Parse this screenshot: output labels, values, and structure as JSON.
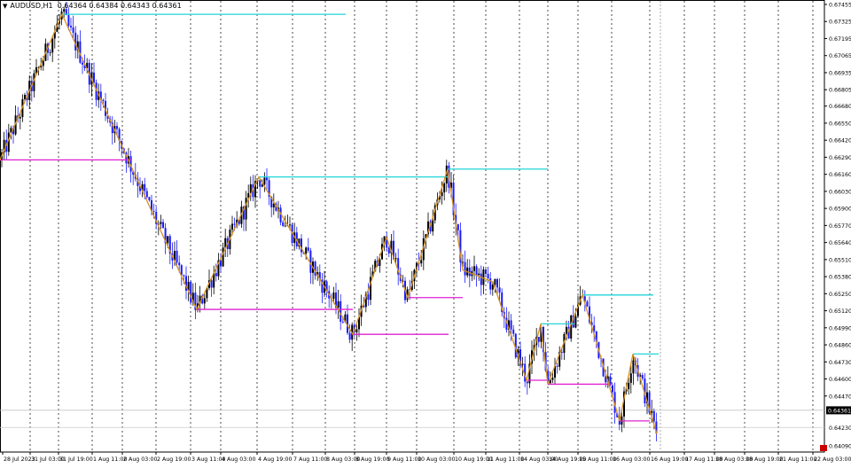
{
  "header": {
    "symbol": "AUDUSD,H1",
    "ohlc": "0.64364 0.64384 0.64343 0.64361"
  },
  "colors": {
    "bull": "#000000",
    "bear": "#1a1aff",
    "zigzag": "#d4901e",
    "support": "#e020d0",
    "resistance": "#22d4d8",
    "grid": "#000000",
    "price_badge": "#000000",
    "sell_marker": "#cc0000"
  },
  "price_axis": {
    "labels": [
      "0.67455",
      "0.67325",
      "0.67195",
      "0.67065",
      "0.66935",
      "0.66805",
      "0.66680",
      "0.66550",
      "0.66420",
      "0.66290",
      "0.66160",
      "0.66030",
      "0.65900",
      "0.65770",
      "0.65640",
      "0.65510",
      "0.65380",
      "0.65250",
      "0.65120",
      "0.64990",
      "0.64860",
      "0.64730",
      "0.64600",
      "0.64470"
    ],
    "current_price": "0.64361",
    "bottom_label": "0.64230",
    "last_label": "0.64090"
  },
  "time_axis": {
    "labels": [
      "28 Jul 2023",
      "31 Jul 03:00",
      "31 Jul 19:00",
      "1 Aug 11:00",
      "2 Aug 03:00",
      "2 Aug 19:00",
      "3 Aug 11:00",
      "4 Aug 03:00",
      "4 Aug 19:00",
      "7 Aug 11:00",
      "8 Aug 03:00",
      "8 Aug 19:00",
      "9 Aug 11:00",
      "10 Aug 03:00",
      "10 Aug 19:00",
      "11 Aug 11:00",
      "14 Aug 03:00",
      "14 Aug 19:00",
      "15 Aug 11:00",
      "16 Aug 03:00",
      "16 Aug 19:00",
      "17 Aug 11:00",
      "18 Aug 03:00",
      "18 Aug 19:00",
      "21 Aug 11:00",
      "22 Aug 03:00"
    ]
  },
  "chart_data": {
    "type": "candlestick",
    "symbol": "AUDUSD",
    "timeframe": "H1",
    "ylim": [
      0.6409,
      0.6746
    ],
    "zigzag": [
      {
        "t": 0,
        "p": 0.6627
      },
      {
        "t": 70,
        "p": 0.6738
      },
      {
        "t": 150,
        "p": 0.6619
      },
      {
        "t": 222,
        "p": 0.6513
      },
      {
        "t": 292,
        "p": 0.6614
      },
      {
        "t": 398,
        "p": 0.6494
      },
      {
        "t": 436,
        "p": 0.6568
      },
      {
        "t": 460,
        "p": 0.6522
      },
      {
        "t": 505,
        "p": 0.662
      },
      {
        "t": 522,
        "p": 0.6543
      },
      {
        "t": 556,
        "p": 0.6534
      },
      {
        "t": 594,
        "p": 0.6459
      },
      {
        "t": 610,
        "p": 0.6502
      },
      {
        "t": 618,
        "p": 0.6456
      },
      {
        "t": 657,
        "p": 0.6524
      },
      {
        "t": 699,
        "p": 0.6428
      },
      {
        "t": 714,
        "p": 0.6479
      },
      {
        "t": 741,
        "p": 0.6418
      }
    ],
    "levels": [
      {
        "kind": "resistance",
        "p": 0.6738,
        "from": 70,
        "to": 390
      },
      {
        "kind": "resistance",
        "p": 0.6614,
        "from": 292,
        "to": 505
      },
      {
        "kind": "resistance",
        "p": 0.662,
        "from": 505,
        "to": 618
      },
      {
        "kind": "resistance",
        "p": 0.6502,
        "from": 610,
        "to": 648
      },
      {
        "kind": "resistance",
        "p": 0.6524,
        "from": 657,
        "to": 737
      },
      {
        "kind": "resistance",
        "p": 0.6479,
        "from": 714,
        "to": 743
      },
      {
        "kind": "support",
        "p": 0.6627,
        "from": 0,
        "to": 148
      },
      {
        "kind": "support",
        "p": 0.6513,
        "from": 222,
        "to": 398
      },
      {
        "kind": "support",
        "p": 0.6494,
        "from": 398,
        "to": 506
      },
      {
        "kind": "support",
        "p": 0.6522,
        "from": 460,
        "to": 522
      },
      {
        "kind": "support",
        "p": 0.6459,
        "from": 594,
        "to": 618
      },
      {
        "kind": "support",
        "p": 0.6456,
        "from": 618,
        "to": 690
      },
      {
        "kind": "support",
        "p": 0.6428,
        "from": 699,
        "to": 733
      }
    ]
  }
}
